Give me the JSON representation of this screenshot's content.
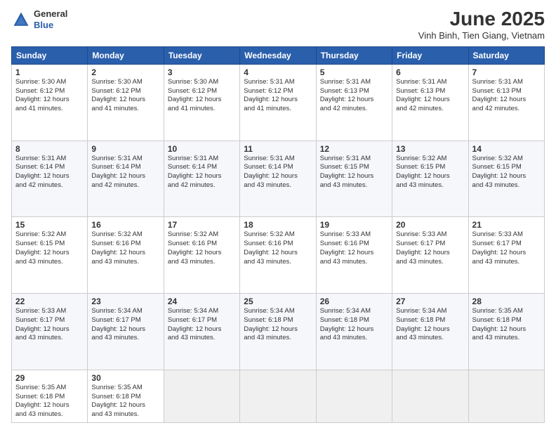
{
  "logo": {
    "general": "General",
    "blue": "Blue"
  },
  "title": "June 2025",
  "subtitle": "Vinh Binh, Tien Giang, Vietnam",
  "weekdays": [
    "Sunday",
    "Monday",
    "Tuesday",
    "Wednesday",
    "Thursday",
    "Friday",
    "Saturday"
  ],
  "weeks": [
    [
      {
        "day": "1",
        "info": "Sunrise: 5:30 AM\nSunset: 6:12 PM\nDaylight: 12 hours\nand 41 minutes."
      },
      {
        "day": "2",
        "info": "Sunrise: 5:30 AM\nSunset: 6:12 PM\nDaylight: 12 hours\nand 41 minutes."
      },
      {
        "day": "3",
        "info": "Sunrise: 5:30 AM\nSunset: 6:12 PM\nDaylight: 12 hours\nand 41 minutes."
      },
      {
        "day": "4",
        "info": "Sunrise: 5:31 AM\nSunset: 6:12 PM\nDaylight: 12 hours\nand 41 minutes."
      },
      {
        "day": "5",
        "info": "Sunrise: 5:31 AM\nSunset: 6:13 PM\nDaylight: 12 hours\nand 42 minutes."
      },
      {
        "day": "6",
        "info": "Sunrise: 5:31 AM\nSunset: 6:13 PM\nDaylight: 12 hours\nand 42 minutes."
      },
      {
        "day": "7",
        "info": "Sunrise: 5:31 AM\nSunset: 6:13 PM\nDaylight: 12 hours\nand 42 minutes."
      }
    ],
    [
      {
        "day": "8",
        "info": "Sunrise: 5:31 AM\nSunset: 6:14 PM\nDaylight: 12 hours\nand 42 minutes."
      },
      {
        "day": "9",
        "info": "Sunrise: 5:31 AM\nSunset: 6:14 PM\nDaylight: 12 hours\nand 42 minutes."
      },
      {
        "day": "10",
        "info": "Sunrise: 5:31 AM\nSunset: 6:14 PM\nDaylight: 12 hours\nand 42 minutes."
      },
      {
        "day": "11",
        "info": "Sunrise: 5:31 AM\nSunset: 6:14 PM\nDaylight: 12 hours\nand 43 minutes."
      },
      {
        "day": "12",
        "info": "Sunrise: 5:31 AM\nSunset: 6:15 PM\nDaylight: 12 hours\nand 43 minutes."
      },
      {
        "day": "13",
        "info": "Sunrise: 5:32 AM\nSunset: 6:15 PM\nDaylight: 12 hours\nand 43 minutes."
      },
      {
        "day": "14",
        "info": "Sunrise: 5:32 AM\nSunset: 6:15 PM\nDaylight: 12 hours\nand 43 minutes."
      }
    ],
    [
      {
        "day": "15",
        "info": "Sunrise: 5:32 AM\nSunset: 6:15 PM\nDaylight: 12 hours\nand 43 minutes."
      },
      {
        "day": "16",
        "info": "Sunrise: 5:32 AM\nSunset: 6:16 PM\nDaylight: 12 hours\nand 43 minutes."
      },
      {
        "day": "17",
        "info": "Sunrise: 5:32 AM\nSunset: 6:16 PM\nDaylight: 12 hours\nand 43 minutes."
      },
      {
        "day": "18",
        "info": "Sunrise: 5:32 AM\nSunset: 6:16 PM\nDaylight: 12 hours\nand 43 minutes."
      },
      {
        "day": "19",
        "info": "Sunrise: 5:33 AM\nSunset: 6:16 PM\nDaylight: 12 hours\nand 43 minutes."
      },
      {
        "day": "20",
        "info": "Sunrise: 5:33 AM\nSunset: 6:17 PM\nDaylight: 12 hours\nand 43 minutes."
      },
      {
        "day": "21",
        "info": "Sunrise: 5:33 AM\nSunset: 6:17 PM\nDaylight: 12 hours\nand 43 minutes."
      }
    ],
    [
      {
        "day": "22",
        "info": "Sunrise: 5:33 AM\nSunset: 6:17 PM\nDaylight: 12 hours\nand 43 minutes."
      },
      {
        "day": "23",
        "info": "Sunrise: 5:34 AM\nSunset: 6:17 PM\nDaylight: 12 hours\nand 43 minutes."
      },
      {
        "day": "24",
        "info": "Sunrise: 5:34 AM\nSunset: 6:17 PM\nDaylight: 12 hours\nand 43 minutes."
      },
      {
        "day": "25",
        "info": "Sunrise: 5:34 AM\nSunset: 6:18 PM\nDaylight: 12 hours\nand 43 minutes."
      },
      {
        "day": "26",
        "info": "Sunrise: 5:34 AM\nSunset: 6:18 PM\nDaylight: 12 hours\nand 43 minutes."
      },
      {
        "day": "27",
        "info": "Sunrise: 5:34 AM\nSunset: 6:18 PM\nDaylight: 12 hours\nand 43 minutes."
      },
      {
        "day": "28",
        "info": "Sunrise: 5:35 AM\nSunset: 6:18 PM\nDaylight: 12 hours\nand 43 minutes."
      }
    ],
    [
      {
        "day": "29",
        "info": "Sunrise: 5:35 AM\nSunset: 6:18 PM\nDaylight: 12 hours\nand 43 minutes."
      },
      {
        "day": "30",
        "info": "Sunrise: 5:35 AM\nSunset: 6:18 PM\nDaylight: 12 hours\nand 43 minutes."
      },
      {
        "day": "",
        "info": ""
      },
      {
        "day": "",
        "info": ""
      },
      {
        "day": "",
        "info": ""
      },
      {
        "day": "",
        "info": ""
      },
      {
        "day": "",
        "info": ""
      }
    ]
  ]
}
